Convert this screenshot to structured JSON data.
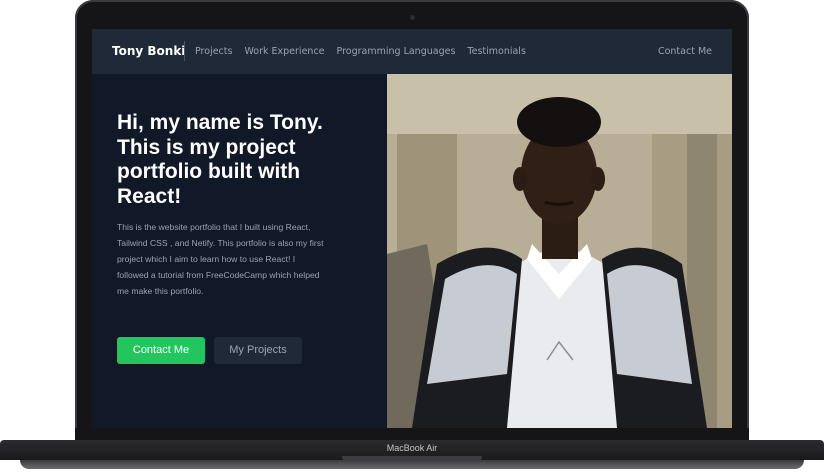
{
  "device": {
    "label": "MacBook Air"
  },
  "navbar": {
    "brand": "Tony Bonki",
    "links": [
      "Projects",
      "Work Experience",
      "Programming Languages",
      "Testimonials"
    ],
    "contact": "Contact Me"
  },
  "hero": {
    "title": "Hi, my name is Tony. This is my project portfolio built with React!",
    "description": "This is the website portfolio that I built using React, Tailwind CSS , and Netify. This portfolio is also my first project which I aim to learn how to use React! I followed a tutorial from FreeCodeCamp which helped me make this portfolio.",
    "primary_button": "Contact Me",
    "secondary_button": "My Projects"
  },
  "colors": {
    "background": "#111827",
    "navbar": "#1f2937",
    "accent": "#22c55e",
    "text_muted": "#9ca3af"
  }
}
